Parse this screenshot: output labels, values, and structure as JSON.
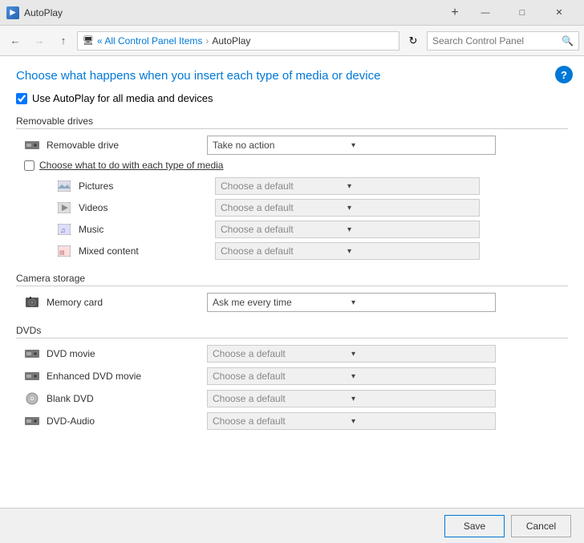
{
  "titlebar": {
    "icon_label": "AP",
    "title": "AutoPlay",
    "btn_minimize": "—",
    "btn_restore": "□",
    "btn_close": "✕",
    "btn_new_tab": "+"
  },
  "addressbar": {
    "breadcrumb_root": "« All Control Panel Items",
    "breadcrumb_current": "AutoPlay",
    "search_placeholder": "Search Control Panel"
  },
  "content": {
    "page_title": "Choose what happens when you insert each type of media or device",
    "autoplay_checkbox_label": "Use AutoPlay for all media and devices",
    "autoplay_checked": true,
    "sections": [
      {
        "id": "removable-drives",
        "header": "Removable drives",
        "items": [
          {
            "id": "removable-drive",
            "label": "Removable drive",
            "icon": "drive",
            "dropdown_value": "Take no action",
            "enabled": true
          }
        ],
        "has_sub_checkbox": true,
        "sub_checkbox_label": "Choose what to do with each type of media",
        "sub_checkbox_checked": false,
        "sub_items": [
          {
            "id": "pictures",
            "label": "Pictures",
            "icon": "img",
            "dropdown_value": "Choose a default"
          },
          {
            "id": "videos",
            "label": "Videos",
            "icon": "video",
            "dropdown_value": "Choose a default"
          },
          {
            "id": "music",
            "label": "Music",
            "icon": "music",
            "dropdown_value": "Choose a default"
          },
          {
            "id": "mixed-content",
            "label": "Mixed content",
            "icon": "mixed",
            "dropdown_value": "Choose a default"
          }
        ]
      },
      {
        "id": "camera-storage",
        "header": "Camera storage",
        "items": [
          {
            "id": "memory-card",
            "label": "Memory card",
            "icon": "camera",
            "dropdown_value": "Ask me every time",
            "enabled": true
          }
        ]
      },
      {
        "id": "dvds",
        "header": "DVDs",
        "items": [
          {
            "id": "dvd-movie",
            "label": "DVD movie",
            "icon": "dvd-drive",
            "dropdown_value": "Choose a default",
            "enabled": false
          },
          {
            "id": "enhanced-dvd-movie",
            "label": "Enhanced DVD movie",
            "icon": "dvd-drive",
            "dropdown_value": "Choose a default",
            "enabled": false
          },
          {
            "id": "blank-dvd",
            "label": "Blank DVD",
            "icon": "dvd",
            "dropdown_value": "Choose a default",
            "enabled": false
          },
          {
            "id": "dvd-audio",
            "label": "DVD-Audio",
            "icon": "dvd-drive",
            "dropdown_value": "Choose a default",
            "enabled": false
          }
        ]
      }
    ]
  },
  "footer": {
    "save_label": "Save",
    "cancel_label": "Cancel"
  }
}
